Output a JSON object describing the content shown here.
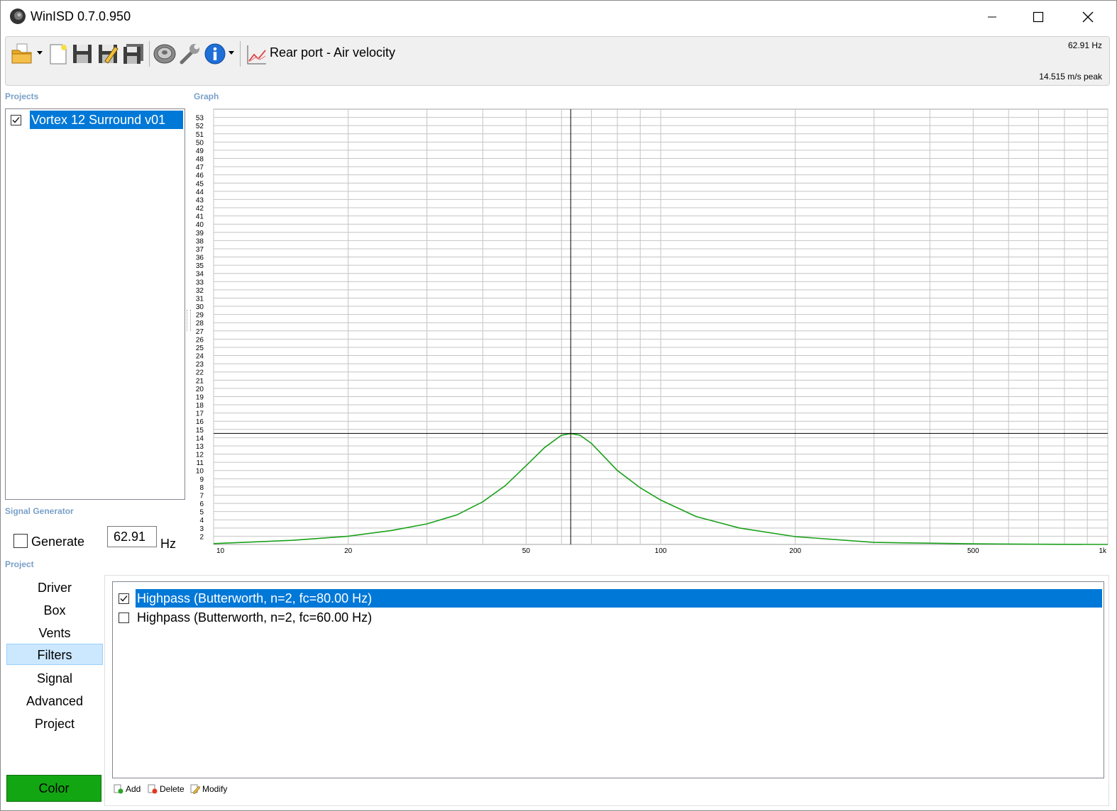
{
  "app": {
    "title": "WinISD 0.7.0.950",
    "icons": {
      "app": "speaker-app-icon",
      "minimize": "minimize-icon",
      "maximize": "maximize-icon",
      "close": "close-icon"
    }
  },
  "toolbar": {
    "icons": [
      "open-folder-icon",
      "new-document-icon",
      "save-icon",
      "save-as-icon",
      "save-all-icon",
      "driver-icon",
      "tools-wrench-icon",
      "info-icon",
      "graph-icon"
    ],
    "graph_type": "Rear port - Air velocity",
    "readout_freq": "62.91 Hz",
    "readout_peak": "14.515 m/s peak"
  },
  "projects": {
    "label": "Projects",
    "items": [
      {
        "label": "Vortex 12 Surround v01",
        "checked": true
      }
    ]
  },
  "graph": {
    "label": "Graph",
    "y_ticks": [
      "2",
      "3",
      "4",
      "5",
      "6",
      "7",
      "8",
      "9",
      "10",
      "11",
      "12",
      "13",
      "14",
      "15",
      "16",
      "17",
      "18",
      "19",
      "20",
      "21",
      "22",
      "23",
      "24",
      "25",
      "26",
      "27",
      "28",
      "29",
      "30",
      "31",
      "32",
      "33",
      "34",
      "35",
      "36",
      "37",
      "38",
      "39",
      "40",
      "41",
      "42",
      "43",
      "44",
      "45",
      "46",
      "47",
      "48",
      "49",
      "50",
      "51",
      "52",
      "53"
    ],
    "x_ticks": [
      "10",
      "20",
      "50",
      "100",
      "200",
      "500",
      "1k"
    ],
    "curve_color": "#1aa01a"
  },
  "chart_data": {
    "type": "line",
    "title": "",
    "xlabel": "",
    "ylabel": "",
    "x_scale": "log",
    "xlim": [
      10,
      1000
    ],
    "ylim": [
      1,
      54
    ],
    "x_ticks": [
      10,
      20,
      50,
      100,
      200,
      500,
      1000
    ],
    "y_ticks": [
      2,
      3,
      4,
      5,
      6,
      7,
      8,
      9,
      10,
      11,
      12,
      13,
      14,
      15,
      16,
      17,
      18,
      19,
      20,
      21,
      22,
      23,
      24,
      25,
      26,
      27,
      28,
      29,
      30,
      31,
      32,
      33,
      34,
      35,
      36,
      37,
      38,
      39,
      40,
      41,
      42,
      43,
      44,
      45,
      46,
      47,
      48,
      49,
      50,
      51,
      52,
      53
    ],
    "grid": true,
    "cursor": {
      "x": 62.91,
      "y": 14.515
    },
    "series": [
      {
        "color": "#1aa01a",
        "x": [
          10,
          15,
          20,
          25,
          30,
          35,
          40,
          45,
          50,
          55,
          60,
          62.91,
          66,
          70,
          75,
          80,
          90,
          100,
          120,
          150,
          200,
          300,
          500,
          700,
          1000
        ],
        "y": [
          1.1,
          1.5,
          2.0,
          2.7,
          3.5,
          4.6,
          6.2,
          8.2,
          10.6,
          12.8,
          14.3,
          14.5,
          14.3,
          13.3,
          11.6,
          10.0,
          7.9,
          6.4,
          4.4,
          3.0,
          1.95,
          1.25,
          1.08,
          1.03,
          1.0
        ]
      }
    ]
  },
  "signal_generator": {
    "label": "Signal Generator",
    "generate_label": "Generate",
    "frequency": "62.91",
    "unit": "Hz"
  },
  "project_nav": {
    "label": "Project",
    "items": [
      "Driver",
      "Box",
      "Vents",
      "Filters",
      "Signal",
      "Advanced",
      "Project"
    ],
    "active": "Filters",
    "color_button": "Color",
    "color_value": "#13a613"
  },
  "filters": {
    "items": [
      {
        "label": "Highpass (Butterworth, n=2, fc=80.00 Hz)",
        "checked": true,
        "selected": true
      },
      {
        "label": "Highpass (Butterworth, n=2, fc=60.00 Hz)",
        "checked": false,
        "selected": false
      }
    ],
    "add_label": "Add",
    "delete_label": "Delete",
    "modify_label": "Modify"
  }
}
